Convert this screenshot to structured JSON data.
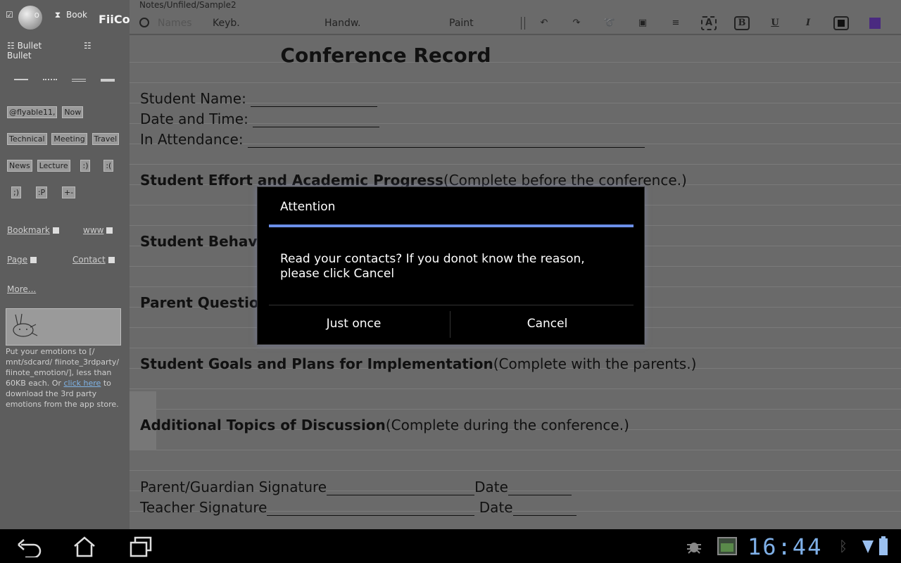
{
  "sidebar": {
    "top": {
      "todo_label": "o",
      "bookmark_label": "Book",
      "app_name": "FiiCo"
    },
    "bullets": [
      "Bullet",
      "Bullet"
    ],
    "tags_row1": [
      "@flyable11,",
      "Now"
    ],
    "tags_row2": [
      "Technical",
      "Meeting",
      "Travel"
    ],
    "tags_row3": [
      "News",
      "Lecture",
      ":)",
      ":("
    ],
    "tags_row4": [
      ";)",
      ":P",
      "+-"
    ],
    "links": {
      "bookmark": "Bookmark",
      "www": "www",
      "page": "Page",
      "contact": "Contact",
      "more": "More..."
    },
    "emotion_hint_pre": "Put your emotions to [/ mnt/sdcard/ fiinote_3rdparty/ fiinote_emotion/], less than 60KB each. Or ",
    "emotion_hint_link": "click here",
    "emotion_hint_post": " to download the 3rd party emotions from the app store."
  },
  "editor": {
    "path": "Notes/Unfiled/Sample2",
    "modes": {
      "keyboard": "Keyb.",
      "handwriting": "Handw.",
      "paint": "Paint"
    },
    "faded_label": "Names",
    "tool_labels": {
      "text_box": "A",
      "bold": "B",
      "underline": "U",
      "italic": "I"
    },
    "colors": {
      "text_color": "#111111",
      "highlight": "#4a2a80"
    },
    "document": {
      "title": "Conference Record",
      "student_name": "Student Name:",
      "date_time": "Date and Time:",
      "attendance": "In Attendance:",
      "effort_bold": "Student Effort and Academic Progress",
      "effort_note": "(Complete before the conference.)",
      "behavior_bold": "Student Behavior",
      "parent_bold": "Parent Questions",
      "goals_bold": "Student Goals and Plans for Implementation",
      "goals_note": "(Complete with the parents.)",
      "topics_bold": "Additional Topics of Discussion",
      "topics_note": "(Complete during the conference.)",
      "parent_sig": "Parent/Guardian Signature",
      "teacher_sig": "Teacher Signature",
      "date_label": "Date"
    }
  },
  "dialog": {
    "title": "Attention",
    "message": "Read your contacts? If you donot know the reason, please click Cancel",
    "confirm": "Just once",
    "cancel": "Cancel"
  },
  "status": {
    "time": "16:44"
  }
}
